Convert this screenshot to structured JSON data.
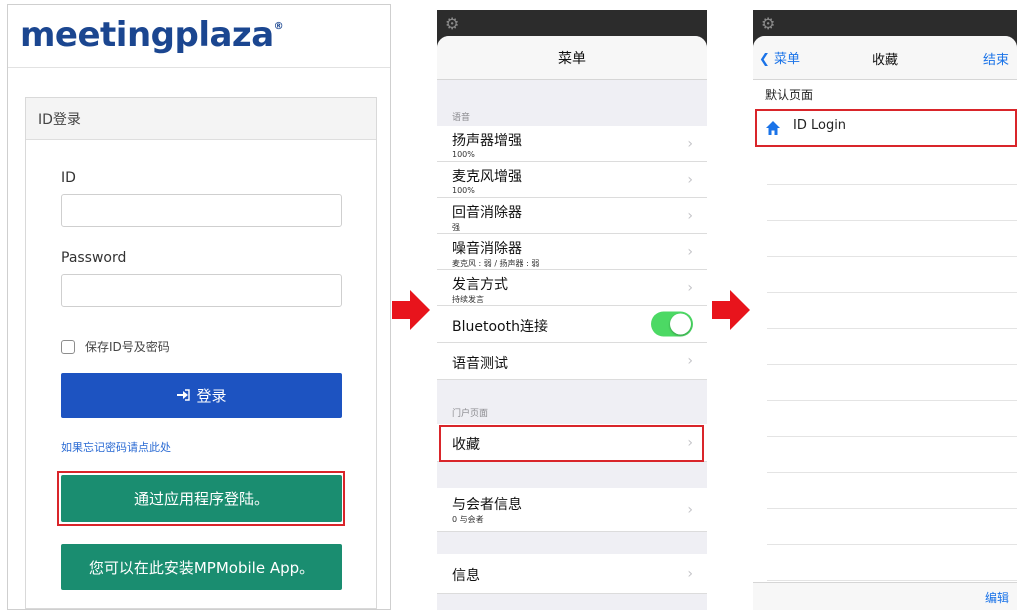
{
  "login": {
    "logo_text": "meetingplaza",
    "logo_mark": "®",
    "card_title": "ID登录",
    "id_label": "ID",
    "id_value": "",
    "password_label": "Password",
    "password_value": "",
    "remember_label": "保存ID号及密码",
    "login_button": "登录",
    "forgot_link": "如果忘记密码请点此处",
    "app_login_button": "通过应用程序登陆。",
    "install_button": "您可以在此安装MPMobile App。"
  },
  "menu": {
    "title": "菜单",
    "section_audio": "语音",
    "items_audio": [
      {
        "label": "扬声器增强",
        "sub": "100%"
      },
      {
        "label": "麦克风增强",
        "sub": "100%"
      },
      {
        "label": "回音消除器",
        "sub": "强"
      },
      {
        "label": "噪音消除器",
        "sub": "麦克风 : 弱 / 扬声器 : 弱"
      },
      {
        "label": "发言方式",
        "sub": "持续发言"
      }
    ],
    "bluetooth_label": "Bluetooth连接",
    "bluetooth_on": true,
    "voice_test_label": "语音测试",
    "section_portal": "门户页面",
    "favorites_label": "收藏",
    "participants_label": "与会者信息",
    "participants_sub": "0 与会者",
    "info_label": "信息"
  },
  "favorites": {
    "back_label": "菜单",
    "title": "收藏",
    "done_label": "结束",
    "default_page_label": "默认页面",
    "item_label": "ID Login",
    "edit_label": "编辑"
  },
  "colors": {
    "brand_blue": "#1b4690",
    "login_blue": "#1d53c1",
    "green": "#1a8d70",
    "highlight_red": "#d9252a",
    "ios_blue": "#1a73e8",
    "toggle_green": "#4cd964"
  }
}
